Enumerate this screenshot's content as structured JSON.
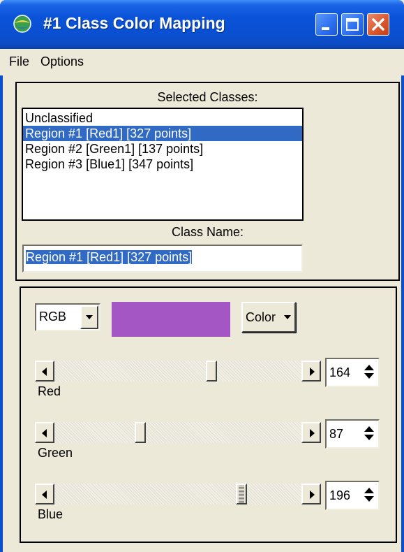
{
  "window": {
    "title": "#1 Class Color Mapping",
    "icon": "globe-icon"
  },
  "menu": {
    "items": [
      "File",
      "Options"
    ]
  },
  "classes": {
    "label": "Selected Classes:",
    "items": [
      "Unclassified",
      "Region #1 [Red1] [327 points]",
      "Region #2 [Green1] [137 points]",
      "Region #3 [Blue1] [347 points]"
    ],
    "selected_index": 1
  },
  "class_name": {
    "label": "Class Name:",
    "value": "Region #1 [Red1] [327 points]"
  },
  "color": {
    "model": "RGB",
    "button_label": "Color",
    "swatch_hex": "#a457c4"
  },
  "sliders": [
    {
      "label": "Red",
      "value": "164",
      "max": 255
    },
    {
      "label": "Green",
      "value": "87",
      "max": 255
    },
    {
      "label": "Blue",
      "value": "196",
      "max": 255
    }
  ],
  "colors": {
    "titlebar": "#0a4fd2",
    "selection": "#316ac5",
    "face": "#ece9d8"
  }
}
